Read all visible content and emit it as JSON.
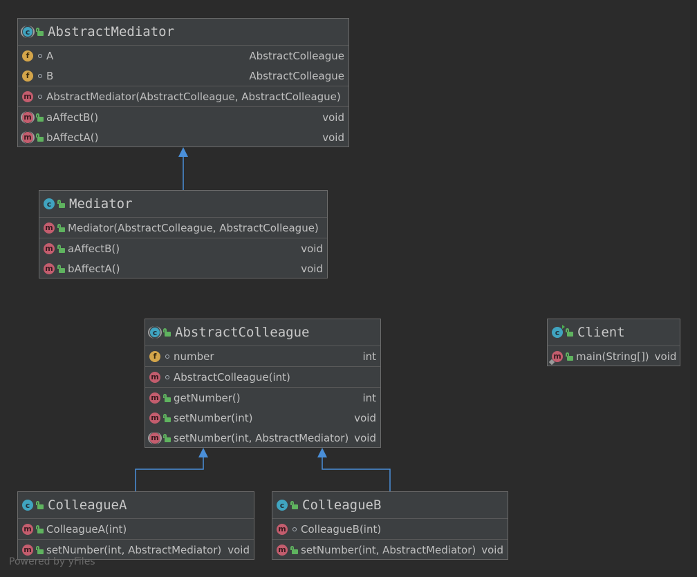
{
  "diagram": {
    "abstract_mediator": {
      "title": "AbstractMediator",
      "fields": [
        {
          "name": "A",
          "type": "AbstractColleague"
        },
        {
          "name": "B",
          "type": "AbstractColleague"
        }
      ],
      "constructors": [
        {
          "name": "AbstractMediator(AbstractColleague, AbstractColleague)",
          "type": ""
        }
      ],
      "methods": [
        {
          "name": "aAffectB()",
          "type": "void"
        },
        {
          "name": "bAffectA()",
          "type": "void"
        }
      ]
    },
    "mediator": {
      "title": "Mediator",
      "constructors": [
        {
          "name": "Mediator(AbstractColleague, AbstractColleague)",
          "type": ""
        }
      ],
      "methods": [
        {
          "name": "aAffectB()",
          "type": "void"
        },
        {
          "name": "bAffectA()",
          "type": "void"
        }
      ]
    },
    "abstract_colleague": {
      "title": "AbstractColleague",
      "fields": [
        {
          "name": "number",
          "type": "int"
        }
      ],
      "constructors": [
        {
          "name": "AbstractColleague(int)",
          "type": ""
        }
      ],
      "methods": [
        {
          "name": "getNumber()",
          "type": "int"
        },
        {
          "name": "setNumber(int)",
          "type": "void"
        },
        {
          "name": "setNumber(int, AbstractMediator)",
          "type": "void"
        }
      ]
    },
    "client": {
      "title": "Client",
      "methods": [
        {
          "name": "main(String[])",
          "type": "void"
        }
      ]
    },
    "colleague_a": {
      "title": "ColleagueA",
      "constructors": [
        {
          "name": "ColleagueA(int)",
          "type": ""
        }
      ],
      "methods": [
        {
          "name": "setNumber(int, AbstractMediator)",
          "type": "void"
        }
      ]
    },
    "colleague_b": {
      "title": "ColleagueB",
      "constructors": [
        {
          "name": "ColleagueB(int)",
          "type": ""
        }
      ],
      "methods": [
        {
          "name": "setNumber(int, AbstractMediator)",
          "type": "void"
        }
      ]
    }
  },
  "footer": {
    "text": "Powered by yFiles"
  },
  "colors": {
    "background": "#2b2b2b",
    "node_fill": "#3c3f41",
    "edge": "#4a8fd9",
    "class_icon": "#40a4c0",
    "field_icon": "#d4a54a",
    "method_icon": "#c45d6e",
    "public_lock": "#5fb35f"
  },
  "icons": {
    "class": "class-icon",
    "abstract_class": "abstract-class-icon",
    "field": "field-icon",
    "method": "method-icon",
    "public": "public-lock-icon",
    "package_private": "package-private-icon"
  }
}
